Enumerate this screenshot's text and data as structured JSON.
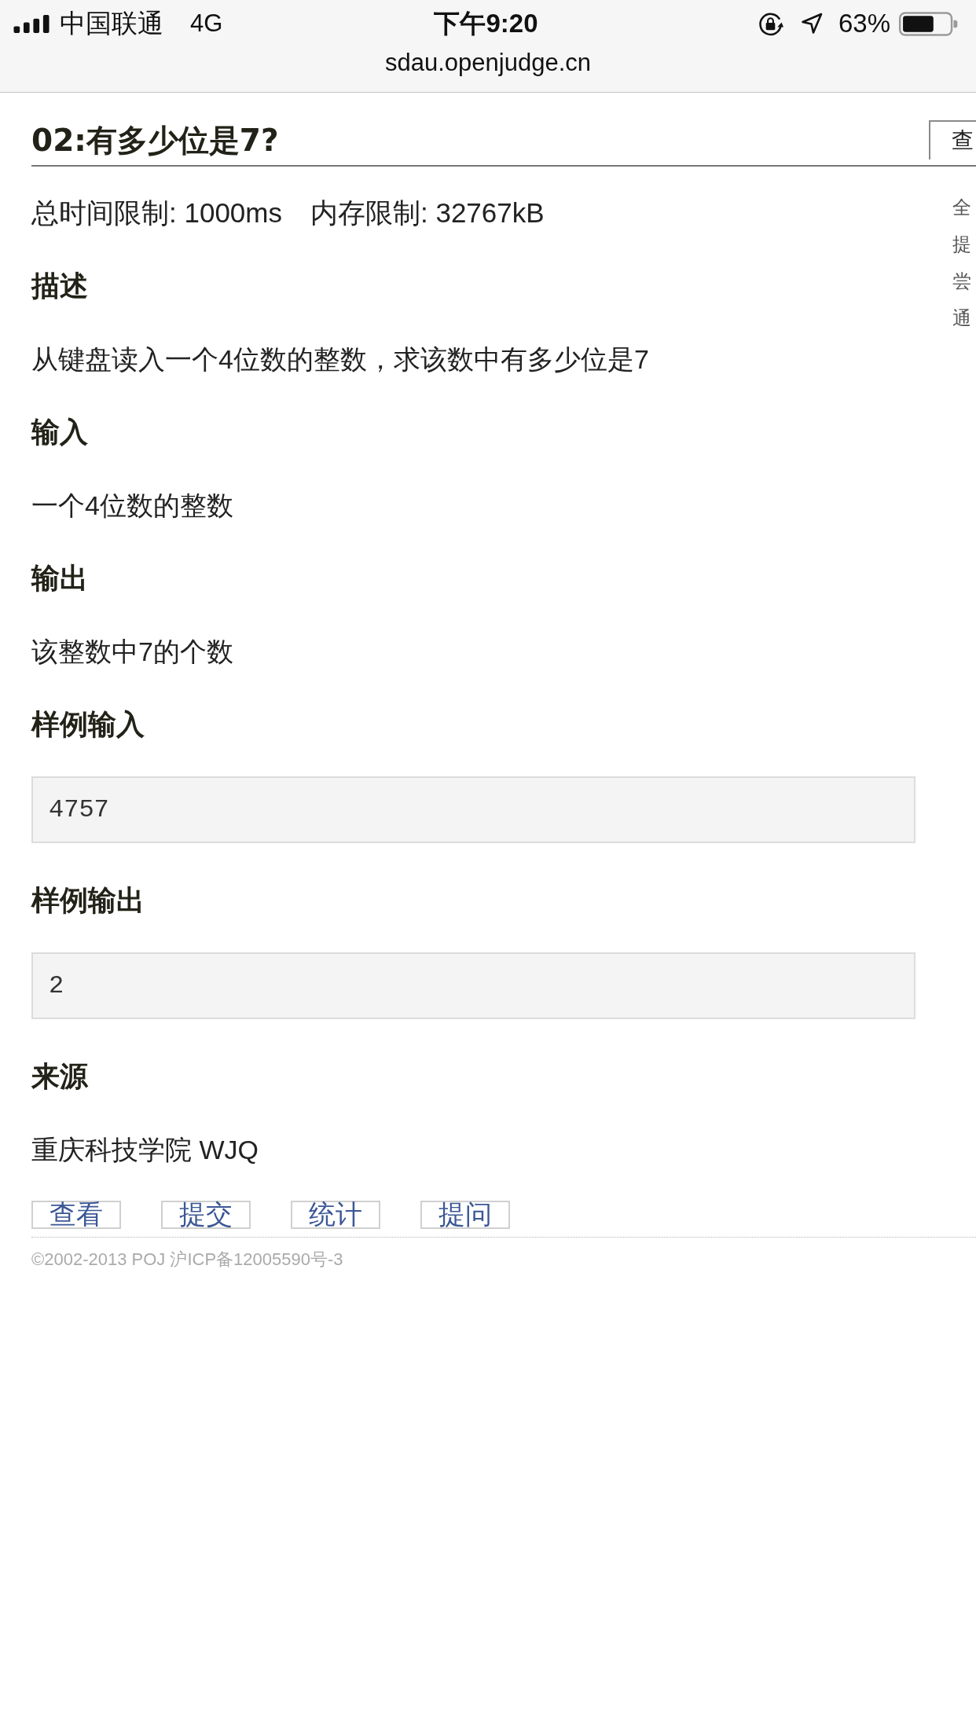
{
  "top_bar": {
    "carrier": "中国联通",
    "network": "4G",
    "time": "下午9:20",
    "battery": "63%",
    "url": "sdau.openjudge.cn"
  },
  "problem": {
    "title": "02:有多少位是7?",
    "limits": [
      "总时间限制: 1000ms",
      "内存限制: 32767kB"
    ],
    "sections": [
      {
        "kind": "text",
        "heading": "描述",
        "text": "从键盘读入一个4位数的整数，求该数中有多少位是7"
      },
      {
        "kind": "text",
        "heading": "输入",
        "text": "一个4位数的整数"
      },
      {
        "kind": "text",
        "heading": "输出",
        "text": "该整数中7的个数"
      },
      {
        "kind": "sample",
        "heading": "样例输入",
        "text": "4757"
      },
      {
        "kind": "sample",
        "heading": "样例输出",
        "text": "2"
      },
      {
        "kind": "text",
        "heading": "来源",
        "text": "重庆科技学院 WJQ"
      }
    ]
  },
  "side_panel": {
    "tab": "查",
    "items": [
      "全",
      "提",
      "尝",
      "通"
    ]
  },
  "actions": [
    "查看",
    "提交",
    "统计",
    "提问"
  ],
  "footer": "©2002-2013 POJ 沪ICP备12005590号-3"
}
